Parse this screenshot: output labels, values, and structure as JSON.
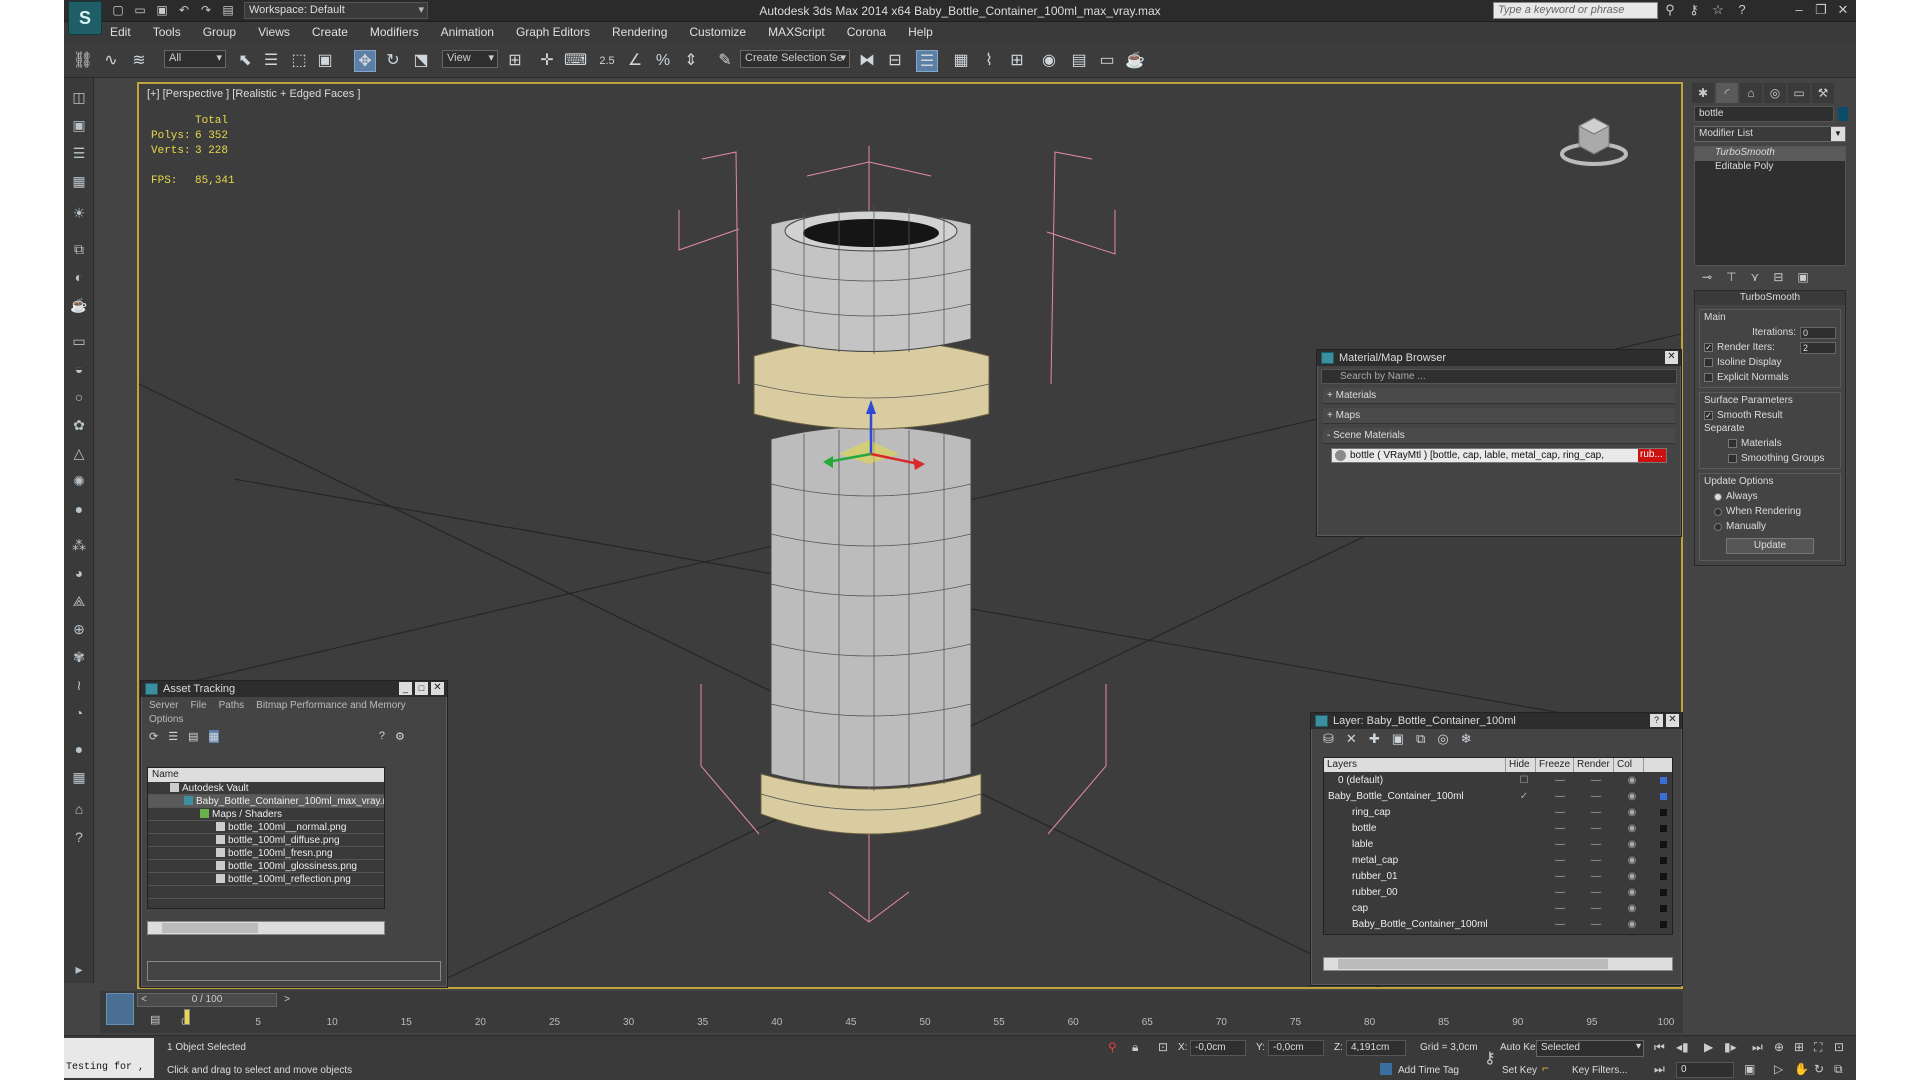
{
  "window": {
    "title": "Autodesk 3ds Max  2014 x64     Baby_Bottle_Container_100ml_max_vray.max",
    "workspace": "Workspace: Default",
    "search_placeholder": "Type a keyword or phrase"
  },
  "menu": [
    "Edit",
    "Tools",
    "Group",
    "Views",
    "Create",
    "Modifiers",
    "Animation",
    "Graph Editors",
    "Rendering",
    "Customize",
    "MAXScript",
    "Corona",
    "Help"
  ],
  "toolbar": {
    "selection_filter": "All",
    "ref_coord": "View",
    "snap_label": "2.5",
    "named_selection": "Create Selection Se"
  },
  "viewport": {
    "label": "[+] [Perspective ] [Realistic + Edged Faces ]",
    "stats": {
      "total_label": "Total",
      "polys_label": "Polys:",
      "polys": "6 352",
      "verts_label": "Verts:",
      "verts": "3 228",
      "fps_label": "FPS:",
      "fps": "85,341"
    }
  },
  "asset_tracking": {
    "title": "Asset Tracking",
    "menu": [
      "Server",
      "File",
      "Paths",
      "Bitmap Performance and Memory"
    ],
    "options": "Options",
    "column": "Name",
    "rows": [
      "Autodesk Vault",
      "Baby_Bottle_Container_100ml_max_vray.max",
      "Maps / Shaders",
      "bottle_100ml__normal.png",
      "bottle_100ml_diffuse.png",
      "bottle_100ml_fresn.png",
      "bottle_100ml_glossiness.png",
      "bottle_100ml_reflection.png"
    ]
  },
  "material_browser": {
    "title": "Material/Map Browser",
    "search": "Search by Name ...",
    "rollouts": [
      "+ Materials",
      "+ Maps",
      "- Scene Materials"
    ],
    "item": "bottle  ( VRayMtl ) [bottle, cap, lable, metal_cap, ring_cap, ",
    "item_err": "rub..."
  },
  "layers": {
    "title": "Layer: Baby_Bottle_Container_100ml",
    "columns": [
      "Layers",
      "Hide",
      "Freeze",
      "Render",
      "Col"
    ],
    "rows": [
      "0 (default)",
      "Baby_Bottle_Container_100ml",
      "ring_cap",
      "bottle",
      "lable",
      "metal_cap",
      "rubber_01",
      "rubber_00",
      "cap",
      "Baby_Bottle_Container_100ml"
    ]
  },
  "command_panel": {
    "object_name": "bottle",
    "modifier_list": "Modifier List",
    "stack": [
      "TurboSmooth",
      "Editable Poly"
    ],
    "turbosmooth": {
      "title": "TurboSmooth",
      "main": "Main",
      "iterations_label": "Iterations:",
      "iterations": "0",
      "render_iters_label": "Render Iters:",
      "render_iters": "2",
      "isoline": "Isoline Display",
      "explicit": "Explicit Normals",
      "surface_params": "Surface Parameters",
      "smooth_result": "Smooth Result",
      "separate": "Separate",
      "materials": "Materials",
      "smoothing_groups": "Smoothing Groups",
      "update_options": "Update Options",
      "always": "Always",
      "when_rendering": "When Rendering",
      "manually": "Manually",
      "update_btn": "Update"
    }
  },
  "timeline": {
    "frame": "0 / 100",
    "ticks": [
      "0",
      "5",
      "10",
      "15",
      "20",
      "25",
      "30",
      "35",
      "40",
      "45",
      "50",
      "55",
      "60",
      "65",
      "70",
      "75",
      "80",
      "85",
      "90",
      "95",
      "100"
    ]
  },
  "status": {
    "maxscript": "Testing for ,",
    "selected": "1 Object Selected",
    "prompt": "Click and drag to select and move objects",
    "x_label": "X:",
    "x": "-0,0cm",
    "y_label": "Y:",
    "y": "-0,0cm",
    "z_label": "Z:",
    "z": "4,191cm",
    "grid": "Grid = 3,0cm",
    "auto_key": "Auto Key",
    "set_key": "Set Key",
    "selected_combo": "Selected",
    "key_filters": "Key Filters...",
    "add_time_tag": "Add Time Tag",
    "frame_field": "0"
  }
}
